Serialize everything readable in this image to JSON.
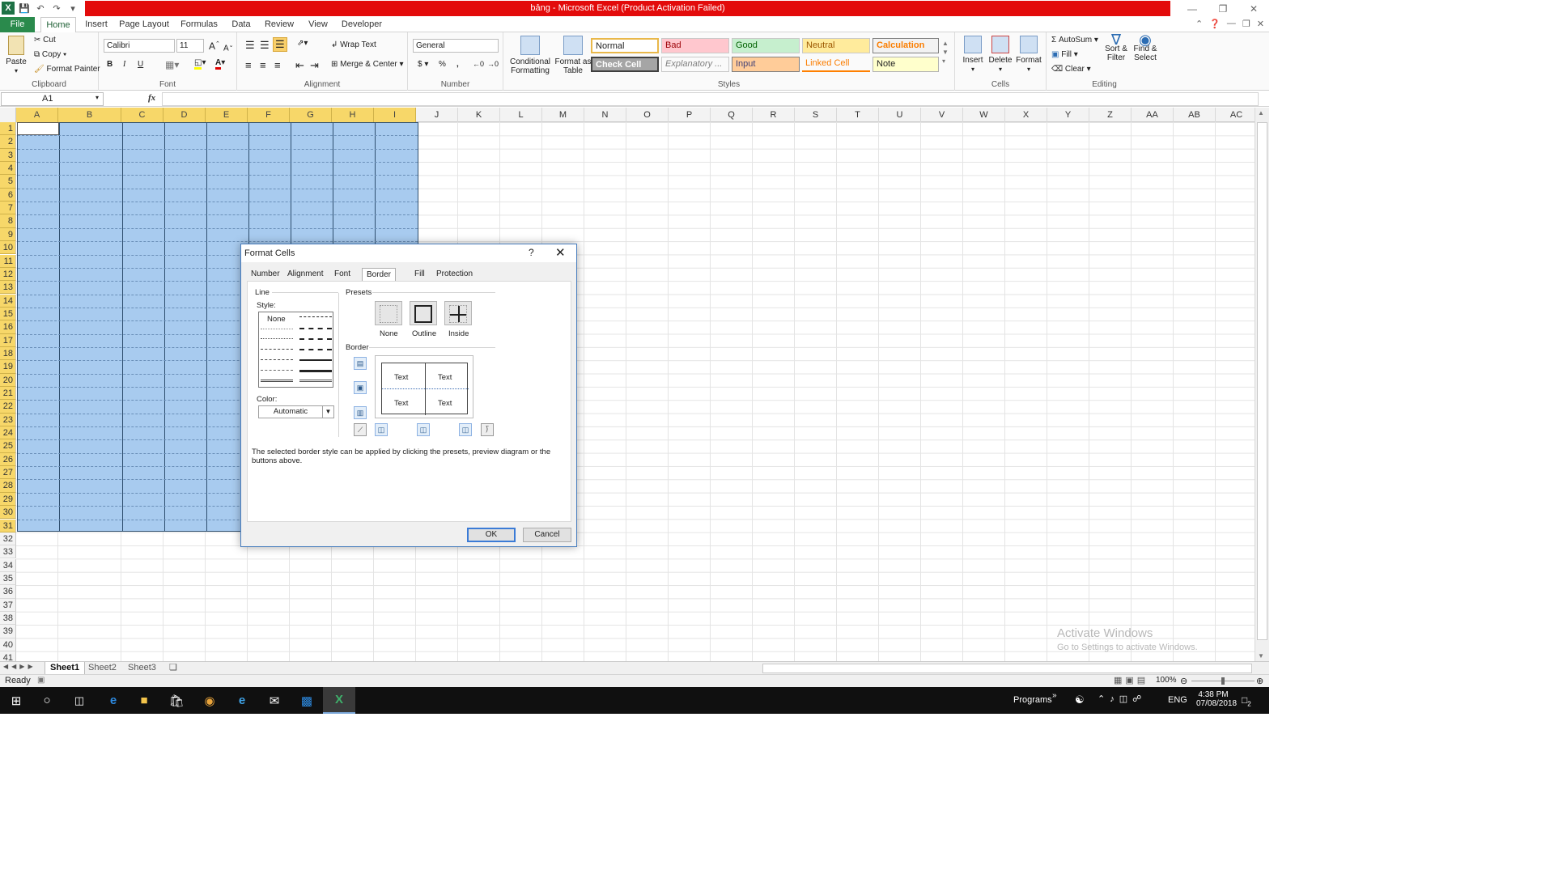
{
  "window": {
    "title": "bảng - Microsoft Excel (Product Activation Failed)"
  },
  "ribbon_tabs": [
    {
      "label": "File"
    },
    {
      "label": "Home"
    },
    {
      "label": "Insert"
    },
    {
      "label": "Page Layout"
    },
    {
      "label": "Formulas"
    },
    {
      "label": "Data"
    },
    {
      "label": "Review"
    },
    {
      "label": "View"
    },
    {
      "label": "Developer"
    }
  ],
  "ribbon": {
    "clipboard": {
      "paste": "Paste",
      "cut": "Cut",
      "copy": "Copy",
      "format_painter": "Format Painter",
      "group": "Clipboard"
    },
    "font": {
      "name": "Calibri",
      "size": "11",
      "bold": "B",
      "italic": "I",
      "underline": "U",
      "group": "Font"
    },
    "alignment": {
      "wrap": "Wrap Text",
      "merge": "Merge & Center",
      "group": "Alignment"
    },
    "number": {
      "format": "General",
      "currency": "$",
      "percent": "%",
      "comma": ",",
      "group": "Number"
    },
    "styles": {
      "conditional": "Conditional Formatting",
      "as_table": "Format as Table",
      "normal": "Normal",
      "bad": "Bad",
      "good": "Good",
      "neutral": "Neutral",
      "calculation": "Calculation",
      "check_cell": "Check Cell",
      "explanatory": "Explanatory ...",
      "input": "Input",
      "linked_cell": "Linked Cell",
      "note": "Note",
      "group": "Styles",
      "colors": {
        "normal_bg": "#ffffff",
        "bad_bg": "#ffc7ce",
        "bad_fg": "#9c0006",
        "good_bg": "#c6efce",
        "good_fg": "#006100",
        "neutral_bg": "#ffeb9c",
        "neutral_fg": "#9c5700",
        "calc_bg": "#f2f2f2",
        "calc_fg": "#fa7d00",
        "check_bg": "#a5a5a5",
        "input_bg": "#ffcc99",
        "linked_fg": "#fa7d00",
        "note_bg": "#ffffcc"
      }
    },
    "cells": {
      "insert": "Insert",
      "delete": "Delete",
      "format": "Format",
      "group": "Cells"
    },
    "editing": {
      "autosum": "AutoSum",
      "fill": "Fill",
      "clear": "Clear",
      "sort": "Sort & Filter",
      "find": "Find & Select",
      "group": "Editing"
    }
  },
  "formula_bar": {
    "name_box": "A1",
    "fx": "fx",
    "formula": ""
  },
  "columns": [
    "A",
    "B",
    "C",
    "D",
    "E",
    "F",
    "G",
    "H",
    "I",
    "J",
    "K",
    "L",
    "M",
    "N",
    "O",
    "P",
    "Q",
    "R",
    "S",
    "T",
    "U",
    "V",
    "W",
    "X",
    "Y",
    "Z",
    "AA",
    "AB",
    "AC"
  ],
  "rows": [
    "1",
    "2",
    "3",
    "4",
    "5",
    "6",
    "7",
    "8",
    "9",
    "10",
    "11",
    "12",
    "13",
    "14",
    "15",
    "16",
    "17",
    "18",
    "19",
    "20",
    "21",
    "22",
    "23",
    "24",
    "25",
    "26",
    "27",
    "28",
    "29",
    "30",
    "31",
    "32",
    "33",
    "34",
    "35",
    "36",
    "37",
    "38",
    "39",
    "40",
    "41"
  ],
  "selection": {
    "range": "A1:I31",
    "fill_color": "#a8cbef"
  },
  "sheets": [
    {
      "label": "Sheet1"
    },
    {
      "label": "Sheet2"
    },
    {
      "label": "Sheet3"
    }
  ],
  "status": {
    "ready": "Ready",
    "zoom": "100%"
  },
  "watermark": {
    "line1": "Activate Windows",
    "line2": "Go to Settings to activate Windows."
  },
  "dialog": {
    "title": "Format Cells",
    "help": "?",
    "tabs": [
      {
        "label": "Number"
      },
      {
        "label": "Alignment"
      },
      {
        "label": "Font"
      },
      {
        "label": "Border"
      },
      {
        "label": "Fill"
      },
      {
        "label": "Protection"
      }
    ],
    "active_tab": "Border",
    "line_label": "Line",
    "style_label": "Style:",
    "style_none": "None",
    "color_label": "Color:",
    "color_value": "Automatic",
    "presets_label": "Presets",
    "presets": [
      {
        "label": "None"
      },
      {
        "label": "Outline"
      },
      {
        "label": "Inside"
      }
    ],
    "border_label": "Border",
    "preview_text": "Text",
    "hint": "The selected border style can be applied by clicking the presets, preview diagram or the buttons above.",
    "ok": "OK",
    "cancel": "Cancel"
  },
  "taskbar": {
    "programs": "Programs",
    "lang": "ENG",
    "time": "4:38 PM",
    "date": "07/08/2018",
    "notifications": "2"
  }
}
